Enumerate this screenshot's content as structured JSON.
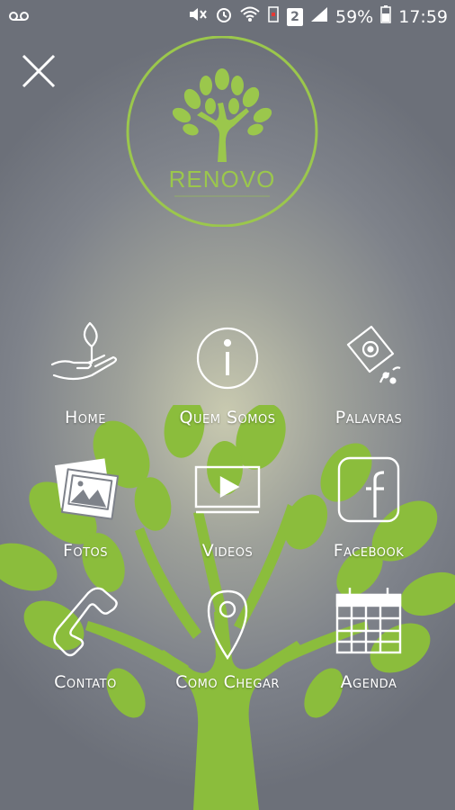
{
  "status_bar": {
    "battery_percent": "59%",
    "time": "17:59",
    "sim_badge": "2"
  },
  "logo": {
    "name": "RENOVO",
    "accent_color": "#8bc34a"
  },
  "menu": {
    "items": [
      {
        "label": "Home",
        "icon": "plant-in-hand-icon"
      },
      {
        "label": "Quem Somos",
        "icon": "info-icon"
      },
      {
        "label": "Palavras",
        "icon": "seed-packet-icon"
      },
      {
        "label": "Fotos",
        "icon": "photos-icon"
      },
      {
        "label": "Videos",
        "icon": "video-player-icon"
      },
      {
        "label": "Facebook",
        "icon": "facebook-icon"
      },
      {
        "label": "Contato",
        "icon": "phone-icon"
      },
      {
        "label": "Como Chegar",
        "icon": "map-pin-icon"
      },
      {
        "label": "Agenda",
        "icon": "calendar-icon"
      }
    ]
  },
  "colors": {
    "tree_green": "#8bbd3c",
    "icon_stroke": "#ffffff"
  }
}
